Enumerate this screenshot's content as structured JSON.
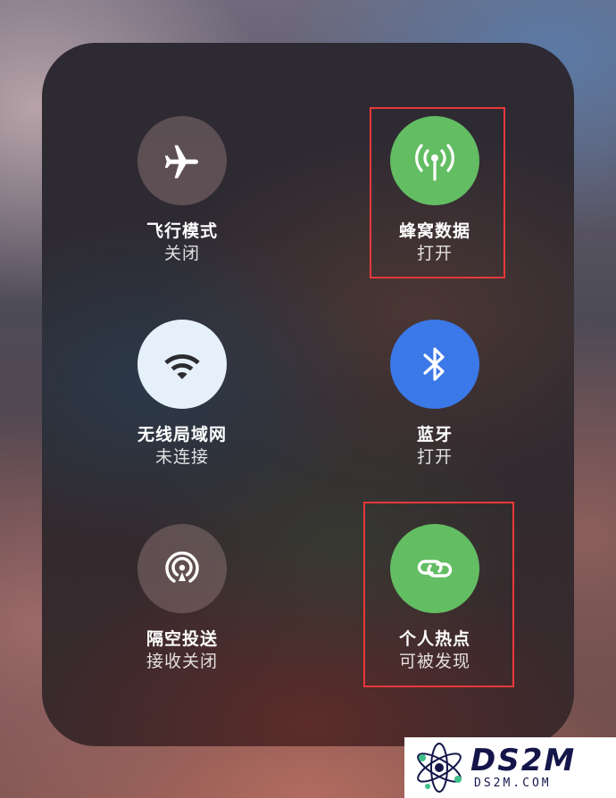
{
  "panel": {
    "tiles": [
      {
        "id": "airplane",
        "label": "飞行模式",
        "status": "关闭",
        "icon": "airplane-icon",
        "state": "off"
      },
      {
        "id": "cellular",
        "label": "蜂窝数据",
        "status": "打开",
        "icon": "antenna-icon",
        "state": "on",
        "color": "#63bd63"
      },
      {
        "id": "wifi",
        "label": "无线局域网",
        "status": "未连接",
        "icon": "wifi-icon",
        "state": "off"
      },
      {
        "id": "bluetooth",
        "label": "蓝牙",
        "status": "打开",
        "icon": "bluetooth-icon",
        "state": "on",
        "color": "#3b78e8"
      },
      {
        "id": "airdrop",
        "label": "隔空投送",
        "status": "接收关闭",
        "icon": "airdrop-icon",
        "state": "off"
      },
      {
        "id": "hotspot",
        "label": "个人热点",
        "status": "可被发现",
        "icon": "hotspot-link-icon",
        "state": "on",
        "color": "#63bd63"
      }
    ]
  },
  "highlight_color": "#e8383a",
  "watermark": {
    "logo": "atom-logo",
    "text": "DS2M",
    "domain": "DS2M.COM"
  }
}
